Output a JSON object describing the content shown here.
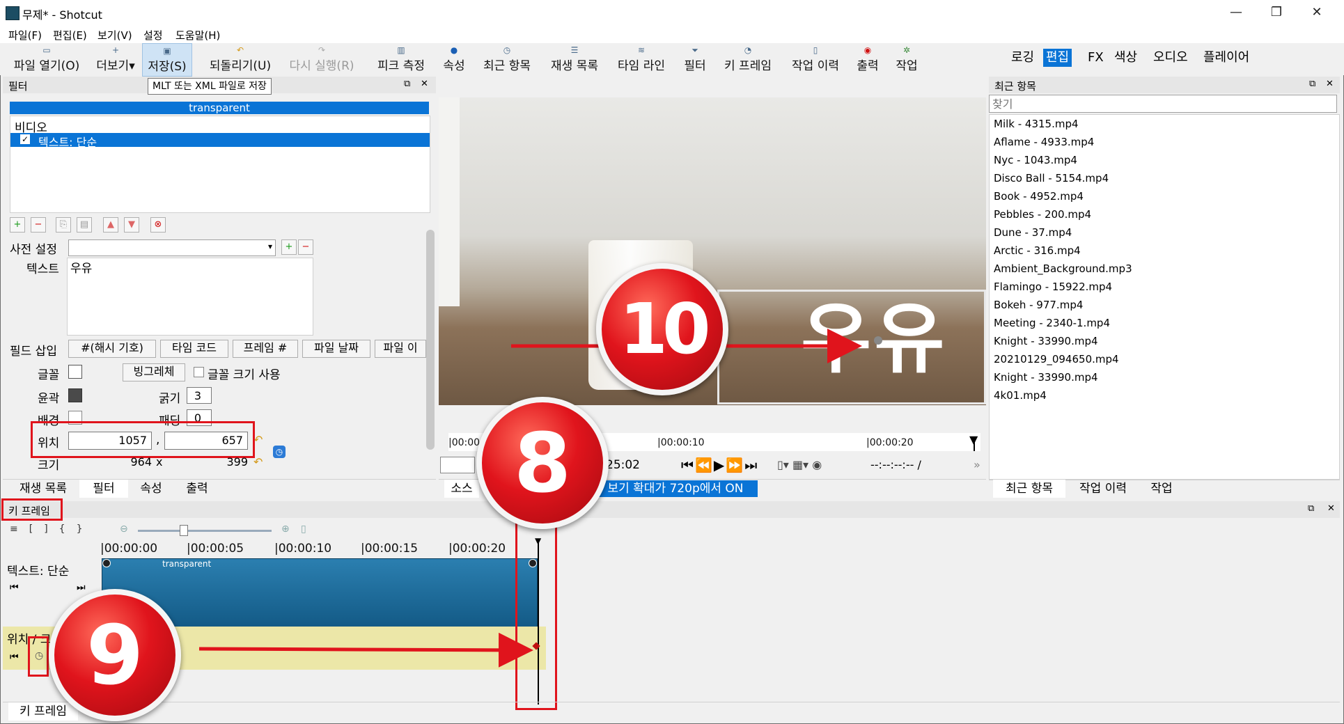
{
  "window": {
    "title": "무제* - Shotcut",
    "minimize": "—",
    "restore": "❐",
    "close": "✕"
  },
  "menu": [
    "파일(F)",
    "편집(E)",
    "보기(V)",
    "설정",
    "도움말(H)"
  ],
  "toolbar": {
    "items": [
      "파일 열기(O)",
      "더보기",
      "저장(S)",
      "되돌리기(U)",
      "다시 실행(R)",
      "피크 측정",
      "속성",
      "최근 항목",
      "재생 목록",
      "타임 라인",
      "필터",
      "키 프레임",
      "작업 이력",
      "출력",
      "작업"
    ],
    "tooltip": "MLT 또는 XML 파일로 저장"
  },
  "workspaces": [
    "로깅",
    "편집",
    "FX",
    "색상",
    "오디오",
    "플레이어"
  ],
  "filters_panel": {
    "title": "필터",
    "clip_name": "transparent",
    "category": "비디오",
    "filter_item": "텍스트: 단순",
    "preset_label": "사전 설정",
    "text_label": "텍스트",
    "text_value": "우유",
    "insert_field_label": "필드 삽입",
    "insert_buttons": [
      "#(해시 기호)",
      "타임 코드",
      "프레임 #",
      "파일 날짜",
      "파일 이"
    ],
    "font_label": "글꼴",
    "font_name": "빙그레체",
    "font_size_label": "글꼴 크기 사용",
    "outline_label": "윤곽",
    "thickness_label": "굵기",
    "thickness_value": "3",
    "bg_label": "배경",
    "padding_label": "패딩",
    "padding_value": "0",
    "position_label": "위치",
    "pos_x": "1057",
    "pos_comma": ",",
    "pos_y": "657",
    "size_label": "크기",
    "size_w": "964",
    "size_x": "x",
    "size_h": "399",
    "tabs": [
      "재생 목록",
      "필터",
      "속성",
      "출력"
    ]
  },
  "player": {
    "overlay_text": "우유",
    "ruler": [
      "|00:00",
      "|00:00:10",
      "|00:00:20"
    ],
    "timecode_right": "25:02",
    "timecode_total": "--:--:--:-- /",
    "more": "»",
    "tabs": [
      "소스"
    ],
    "status": "보기 확대가 720p에서 ON"
  },
  "recent_panel": {
    "title": "최근 항목",
    "search_placeholder": "찾기",
    "items": [
      "Milk - 4315.mp4",
      "Aflame - 4933.mp4",
      "Nyc - 1043.mp4",
      "Disco Ball - 5154.mp4",
      "Book - 4952.mp4",
      "Pebbles - 200.mp4",
      "Dune - 37.mp4",
      "Arctic - 316.mp4",
      "Ambient_Background.mp3",
      "Flamingo - 15922.mp4",
      "Bokeh - 977.mp4",
      "Meeting - 2340-1.mp4",
      "Knight - 33990.mp4",
      "20210129_094650.mp4",
      "Knight - 33990.mp4",
      "4k01.mp4"
    ],
    "tabs": [
      "최근 항목",
      "작업 이력",
      "작업"
    ]
  },
  "keyframes_panel": {
    "title": "키 프레임",
    "ruler": [
      "|00:00:00",
      "|00:00:05",
      "|00:00:10",
      "|00:00:15",
      "|00:00:20"
    ],
    "track1": "텍스트: 단순",
    "clip_label": "transparent",
    "track2": "위치 / 크",
    "tab": "키 프레임"
  },
  "annotations": {
    "badge8": "8",
    "badge9": "9",
    "badge10": "10"
  }
}
